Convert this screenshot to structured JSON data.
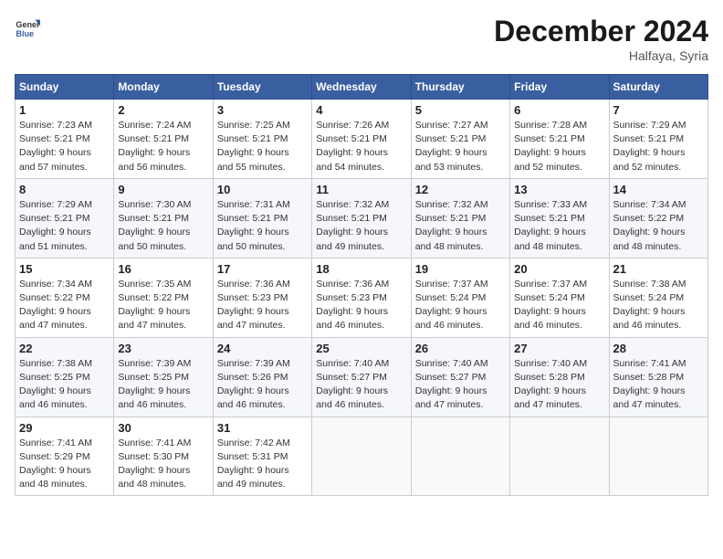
{
  "header": {
    "logo_line1": "General",
    "logo_line2": "Blue",
    "month": "December 2024",
    "location": "Halfaya, Syria"
  },
  "weekdays": [
    "Sunday",
    "Monday",
    "Tuesday",
    "Wednesday",
    "Thursday",
    "Friday",
    "Saturday"
  ],
  "weeks": [
    [
      {
        "day": "1",
        "info": "Sunrise: 7:23 AM\nSunset: 5:21 PM\nDaylight: 9 hours\nand 57 minutes."
      },
      {
        "day": "2",
        "info": "Sunrise: 7:24 AM\nSunset: 5:21 PM\nDaylight: 9 hours\nand 56 minutes."
      },
      {
        "day": "3",
        "info": "Sunrise: 7:25 AM\nSunset: 5:21 PM\nDaylight: 9 hours\nand 55 minutes."
      },
      {
        "day": "4",
        "info": "Sunrise: 7:26 AM\nSunset: 5:21 PM\nDaylight: 9 hours\nand 54 minutes."
      },
      {
        "day": "5",
        "info": "Sunrise: 7:27 AM\nSunset: 5:21 PM\nDaylight: 9 hours\nand 53 minutes."
      },
      {
        "day": "6",
        "info": "Sunrise: 7:28 AM\nSunset: 5:21 PM\nDaylight: 9 hours\nand 52 minutes."
      },
      {
        "day": "7",
        "info": "Sunrise: 7:29 AM\nSunset: 5:21 PM\nDaylight: 9 hours\nand 52 minutes."
      }
    ],
    [
      {
        "day": "8",
        "info": "Sunrise: 7:29 AM\nSunset: 5:21 PM\nDaylight: 9 hours\nand 51 minutes."
      },
      {
        "day": "9",
        "info": "Sunrise: 7:30 AM\nSunset: 5:21 PM\nDaylight: 9 hours\nand 50 minutes."
      },
      {
        "day": "10",
        "info": "Sunrise: 7:31 AM\nSunset: 5:21 PM\nDaylight: 9 hours\nand 50 minutes."
      },
      {
        "day": "11",
        "info": "Sunrise: 7:32 AM\nSunset: 5:21 PM\nDaylight: 9 hours\nand 49 minutes."
      },
      {
        "day": "12",
        "info": "Sunrise: 7:32 AM\nSunset: 5:21 PM\nDaylight: 9 hours\nand 48 minutes."
      },
      {
        "day": "13",
        "info": "Sunrise: 7:33 AM\nSunset: 5:21 PM\nDaylight: 9 hours\nand 48 minutes."
      },
      {
        "day": "14",
        "info": "Sunrise: 7:34 AM\nSunset: 5:22 PM\nDaylight: 9 hours\nand 48 minutes."
      }
    ],
    [
      {
        "day": "15",
        "info": "Sunrise: 7:34 AM\nSunset: 5:22 PM\nDaylight: 9 hours\nand 47 minutes."
      },
      {
        "day": "16",
        "info": "Sunrise: 7:35 AM\nSunset: 5:22 PM\nDaylight: 9 hours\nand 47 minutes."
      },
      {
        "day": "17",
        "info": "Sunrise: 7:36 AM\nSunset: 5:23 PM\nDaylight: 9 hours\nand 47 minutes."
      },
      {
        "day": "18",
        "info": "Sunrise: 7:36 AM\nSunset: 5:23 PM\nDaylight: 9 hours\nand 46 minutes."
      },
      {
        "day": "19",
        "info": "Sunrise: 7:37 AM\nSunset: 5:24 PM\nDaylight: 9 hours\nand 46 minutes."
      },
      {
        "day": "20",
        "info": "Sunrise: 7:37 AM\nSunset: 5:24 PM\nDaylight: 9 hours\nand 46 minutes."
      },
      {
        "day": "21",
        "info": "Sunrise: 7:38 AM\nSunset: 5:24 PM\nDaylight: 9 hours\nand 46 minutes."
      }
    ],
    [
      {
        "day": "22",
        "info": "Sunrise: 7:38 AM\nSunset: 5:25 PM\nDaylight: 9 hours\nand 46 minutes."
      },
      {
        "day": "23",
        "info": "Sunrise: 7:39 AM\nSunset: 5:25 PM\nDaylight: 9 hours\nand 46 minutes."
      },
      {
        "day": "24",
        "info": "Sunrise: 7:39 AM\nSunset: 5:26 PM\nDaylight: 9 hours\nand 46 minutes."
      },
      {
        "day": "25",
        "info": "Sunrise: 7:40 AM\nSunset: 5:27 PM\nDaylight: 9 hours\nand 46 minutes."
      },
      {
        "day": "26",
        "info": "Sunrise: 7:40 AM\nSunset: 5:27 PM\nDaylight: 9 hours\nand 47 minutes."
      },
      {
        "day": "27",
        "info": "Sunrise: 7:40 AM\nSunset: 5:28 PM\nDaylight: 9 hours\nand 47 minutes."
      },
      {
        "day": "28",
        "info": "Sunrise: 7:41 AM\nSunset: 5:28 PM\nDaylight: 9 hours\nand 47 minutes."
      }
    ],
    [
      {
        "day": "29",
        "info": "Sunrise: 7:41 AM\nSunset: 5:29 PM\nDaylight: 9 hours\nand 48 minutes."
      },
      {
        "day": "30",
        "info": "Sunrise: 7:41 AM\nSunset: 5:30 PM\nDaylight: 9 hours\nand 48 minutes."
      },
      {
        "day": "31",
        "info": "Sunrise: 7:42 AM\nSunset: 5:31 PM\nDaylight: 9 hours\nand 49 minutes."
      },
      null,
      null,
      null,
      null
    ]
  ]
}
